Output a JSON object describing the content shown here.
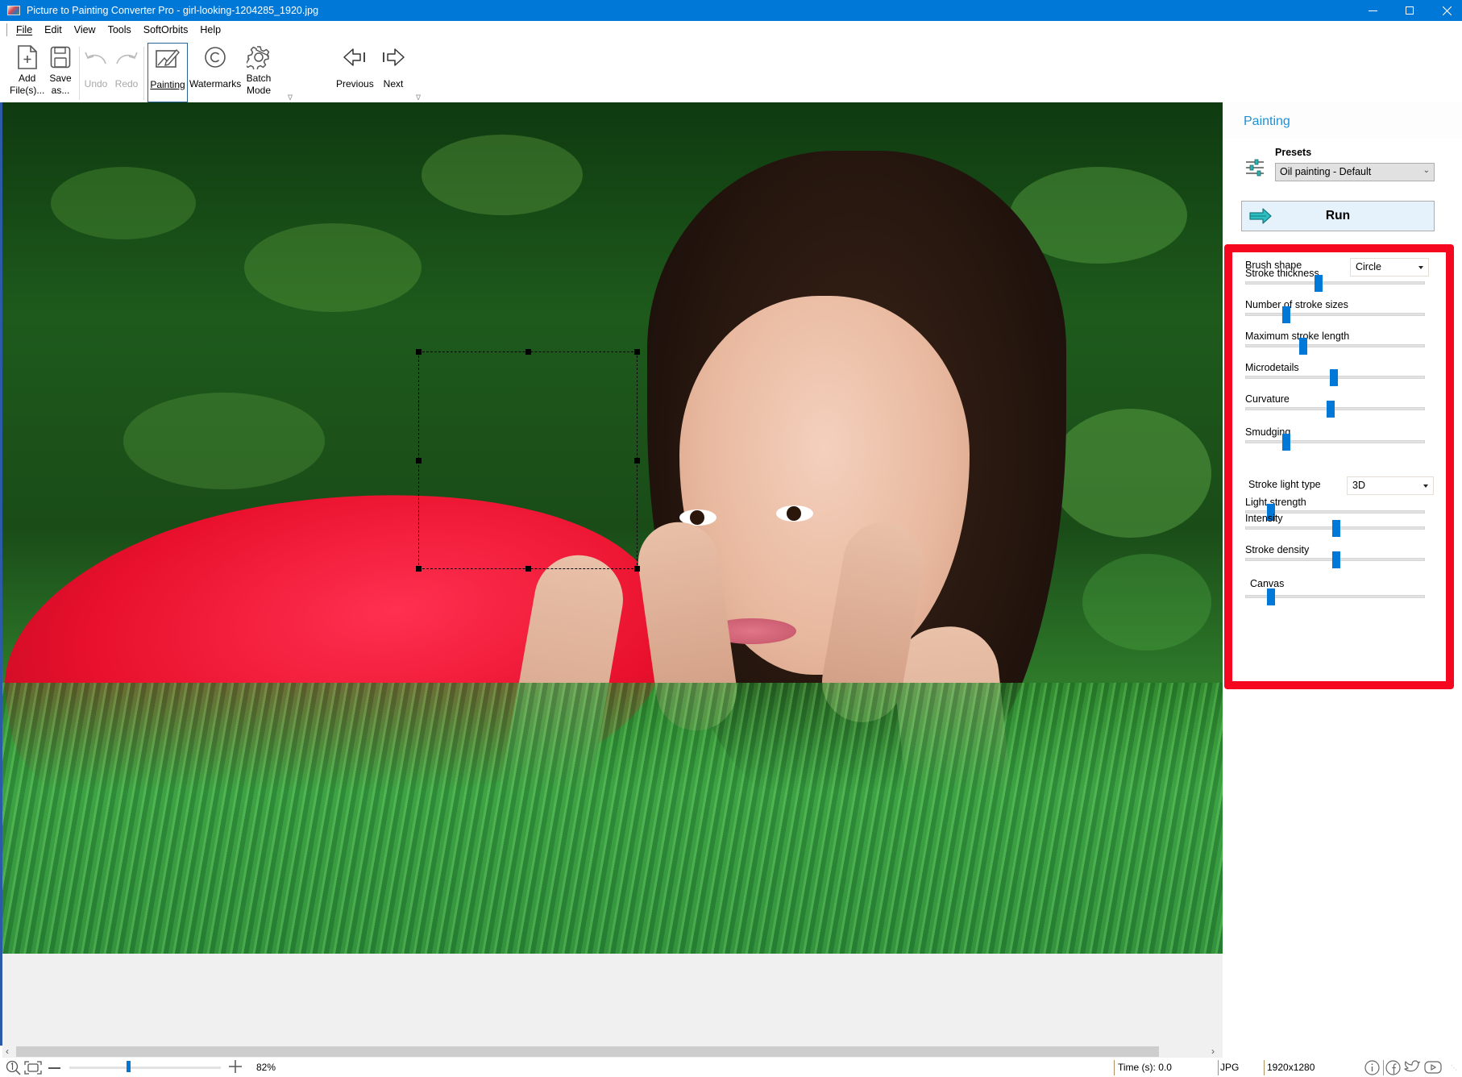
{
  "window": {
    "title": "Picture to Painting Converter Pro - girl-looking-1204285_1920.jpg",
    "controls": [
      "minimize",
      "maximize",
      "close"
    ]
  },
  "menu": {
    "items": [
      {
        "label": "File",
        "accel": "F"
      },
      {
        "label": "Edit",
        "accel": "E"
      },
      {
        "label": "View",
        "accel": "V"
      },
      {
        "label": "Tools",
        "accel": "T"
      },
      {
        "label": "SoftOrbits",
        "accel": ""
      },
      {
        "label": "Help",
        "accel": "H"
      }
    ]
  },
  "toolbar": {
    "add_files": {
      "line1": "Add",
      "line2": "File(s)...",
      "icon": "add-file-icon"
    },
    "save_as": {
      "line1": "Save",
      "line2": "as...",
      "icon": "save-icon"
    },
    "undo": {
      "label": "Undo",
      "icon": "undo-icon",
      "enabled": false
    },
    "redo": {
      "label": "Redo",
      "icon": "redo-icon",
      "enabled": false
    },
    "painting": {
      "label": "Painting",
      "icon": "painting-icon",
      "active": true
    },
    "watermarks": {
      "label": "Watermarks",
      "icon": "copyright-icon"
    },
    "batch_mode": {
      "line1": "Batch",
      "line2": "Mode",
      "icon": "gear-icon"
    },
    "previous": {
      "label": "Previous",
      "icon": "arrow-left-icon"
    },
    "next": {
      "label": "Next",
      "icon": "arrow-right-icon"
    }
  },
  "canvas": {
    "image_description": "Girl with dark curly hair in red dress lying on grass, chin resting on hands, green foliage background",
    "selection_active": true
  },
  "panel": {
    "title": "Painting",
    "presets_label": "Presets",
    "preset_value": "Oil painting - Default",
    "run_label": "Run",
    "settings": {
      "brush_shape": {
        "label": "Brush shape",
        "value": "Circle"
      },
      "stroke_light_type": {
        "label": "Stroke light type",
        "value": "3D"
      },
      "sliders": [
        {
          "label": "Stroke thickness",
          "value": 0.4
        },
        {
          "label": "Number of stroke sizes",
          "value": 0.21
        },
        {
          "label": "Maximum stroke length",
          "value": 0.31
        },
        {
          "label": "Microdetails",
          "value": 0.49
        },
        {
          "label": "Curvature",
          "value": 0.47
        },
        {
          "label": "Smudging",
          "value": 0.21
        },
        {
          "label": "Light strength",
          "value": 0.12
        },
        {
          "label": "Intensity",
          "value": 0.5
        },
        {
          "label": "Stroke density",
          "value": 0.5
        },
        {
          "label": "Canvas",
          "value": 0.12
        }
      ]
    },
    "highlight_color": "#f5071f"
  },
  "statusbar": {
    "zoom_percent": "82%",
    "zoom_slider_value": 0.38,
    "time": "Time (s): 0.0",
    "format": "JPG",
    "dimensions": "1920x1280",
    "social_icons": [
      "info-icon",
      "facebook-icon",
      "twitter-icon",
      "youtube-icon"
    ]
  },
  "colors": {
    "titlebar": "#0078d7",
    "accent": "#0078d7",
    "panel_title": "#1e90d6",
    "run_button_bg": "#e5f1fb"
  }
}
